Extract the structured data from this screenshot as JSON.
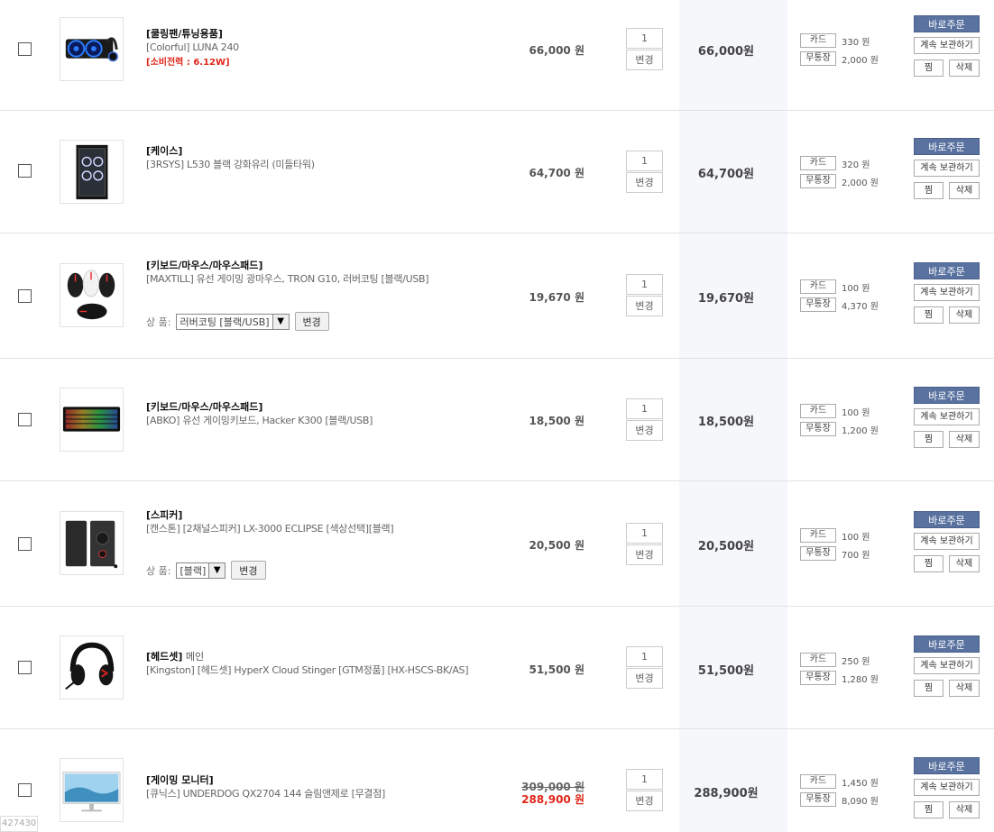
{
  "labels": {
    "card": "카드",
    "free": "무통장",
    "buy": "바로주문",
    "keep": "계속 보관하기",
    "jjim": "찜",
    "delete": "삭제",
    "change": "변경",
    "option_label": "상 품:"
  },
  "items": [
    {
      "category": "[쿨링팬/튜닝용품]",
      "category_sub": "",
      "name": "[Colorful] LUNA 240",
      "warn": "[소비전력 : 6.12W]",
      "price": "66,000 원",
      "qty": "1",
      "total": "66,000원",
      "card_pt": "330 원",
      "free_pt": "2,000 원",
      "thumb": "cooler-image"
    },
    {
      "category": "[케이스]",
      "category_sub": "",
      "name": "[3RSYS] L530 블랙 강화유리 (미들타워)",
      "price": "64,700 원",
      "qty": "1",
      "total": "64,700원",
      "card_pt": "320 원",
      "free_pt": "2,000 원",
      "thumb": "case-image"
    },
    {
      "category": "[키보드/마우스/마우스패드]",
      "category_sub": "",
      "name": "[MAXTILL] 유선 게이밍 광마우스, TRON G10, 러버코팅 [블랙/USB]",
      "option": "러버코팅 [블랙/USB]",
      "price": "19,670 원",
      "qty": "1",
      "total": "19,670원",
      "card_pt": "100 원",
      "free_pt": "4,370 원",
      "thumb": "mouse-image"
    },
    {
      "category": "[키보드/마우스/마우스패드]",
      "category_sub": "",
      "name": "[ABKO] 유선 게이밍키보드, Hacker K300 [블랙/USB]",
      "price": "18,500 원",
      "qty": "1",
      "total": "18,500원",
      "card_pt": "100 원",
      "free_pt": "1,200 원",
      "thumb": "keyboard-image"
    },
    {
      "category": "[스피커]",
      "category_sub": "",
      "name": "[캔스톤] [2채널스피커] LX-3000 ECLIPSE [색상선택][블랙]",
      "option": "[블랙]",
      "price": "20,500 원",
      "qty": "1",
      "total": "20,500원",
      "card_pt": "100 원",
      "free_pt": "700 원",
      "thumb": "speaker-image"
    },
    {
      "category": "[헤드셋]",
      "category_sub": " 메인",
      "name": "[Kingston] [헤드셋] HyperX Cloud Stinger [GTM정품] [HX-HSCS-BK/AS]",
      "price": "51,500 원",
      "qty": "1",
      "total": "51,500원",
      "card_pt": "250 원",
      "free_pt": "1,280 원",
      "thumb": "headset-image"
    },
    {
      "category": "[게이밍 모니터]",
      "category_sub": "",
      "name": "[큐닉스] UNDERDOG QX2704 144 슬림앤제로 [무결점]",
      "price_old": "309,000 원",
      "price": "288,900 원",
      "qty": "1",
      "total": "288,900원",
      "card_pt": "1,450 원",
      "free_pt": "8,090 원",
      "thumb": "monitor-image"
    }
  ],
  "corner_text": "427430"
}
